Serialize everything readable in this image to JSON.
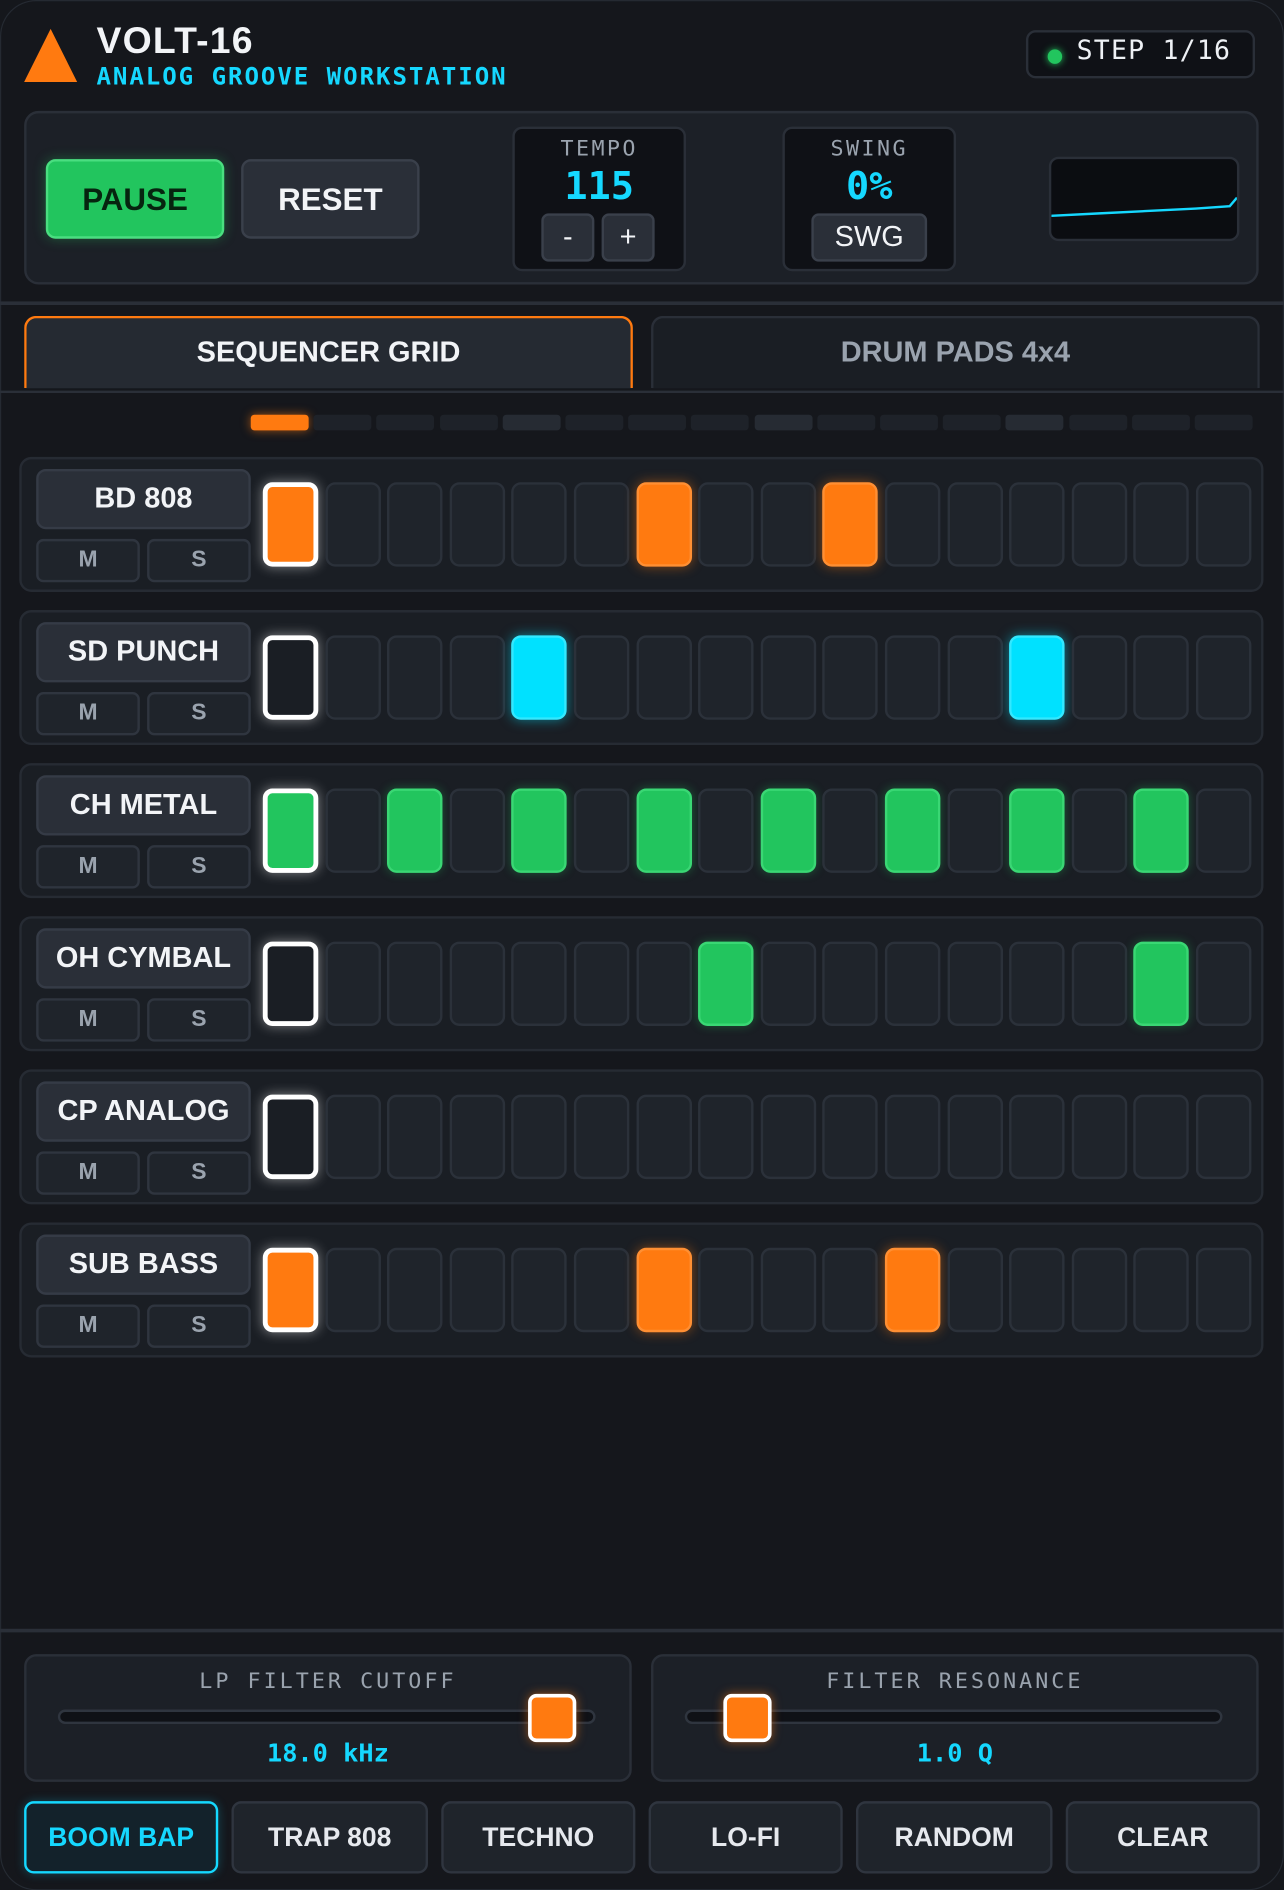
{
  "header": {
    "title": "VOLT-16",
    "subtitle": "ANALOG GROOVE WORKSTATION",
    "step_label": "STEP 1/16"
  },
  "transport": {
    "pause_label": "PAUSE",
    "reset_label": "RESET",
    "tempo": {
      "label": "TEMPO",
      "value": "115",
      "minus": "-",
      "plus": "+"
    },
    "swing": {
      "label": "SWING",
      "value": "0%",
      "button": "SWG"
    }
  },
  "tabs": [
    {
      "label": "SEQUENCER GRID",
      "active": true
    },
    {
      "label": "DRUM PADS 4x4",
      "active": false
    }
  ],
  "current_step": 1,
  "total_steps": 16,
  "tracks": [
    {
      "name": "BD 808",
      "mute": "M",
      "solo": "S",
      "color": "#ff7a10",
      "active_steps": [
        1,
        7,
        10
      ]
    },
    {
      "name": "SD PUNCH",
      "mute": "M",
      "solo": "S",
      "color": "#00e1ff",
      "active_steps": [
        5,
        13
      ]
    },
    {
      "name": "CH METAL",
      "mute": "M",
      "solo": "S",
      "color": "#22c55e",
      "active_steps": [
        1,
        3,
        5,
        7,
        9,
        11,
        13,
        15
      ]
    },
    {
      "name": "OH CYMBAL",
      "mute": "M",
      "solo": "S",
      "color": "#22c55e",
      "active_steps": [
        8,
        15
      ]
    },
    {
      "name": "CP ANALOG",
      "mute": "M",
      "solo": "S",
      "color": "#22c55e",
      "active_steps": []
    },
    {
      "name": "SUB BASS",
      "mute": "M",
      "solo": "S",
      "color": "#ff7a10",
      "active_steps": [
        1,
        7,
        11
      ]
    }
  ],
  "filters": {
    "cutoff": {
      "label": "LP FILTER CUTOFF",
      "value": "18.0 kHz",
      "level": 0.96
    },
    "resonance": {
      "label": "FILTER RESONANCE",
      "value": "1.0 Q",
      "level": 0.08
    }
  },
  "presets": [
    {
      "label": "BOOM BAP",
      "active": true
    },
    {
      "label": "TRAP 808",
      "active": false
    },
    {
      "label": "TECHNO",
      "active": false
    },
    {
      "label": "LO-FI",
      "active": false
    },
    {
      "label": "RANDOM",
      "active": false
    },
    {
      "label": "CLEAR",
      "active": false
    }
  ],
  "colors": {
    "accent_orange": "#ff7a10",
    "accent_cyan": "#15d8ff",
    "accent_green": "#22c55e",
    "background": "#15171c"
  }
}
